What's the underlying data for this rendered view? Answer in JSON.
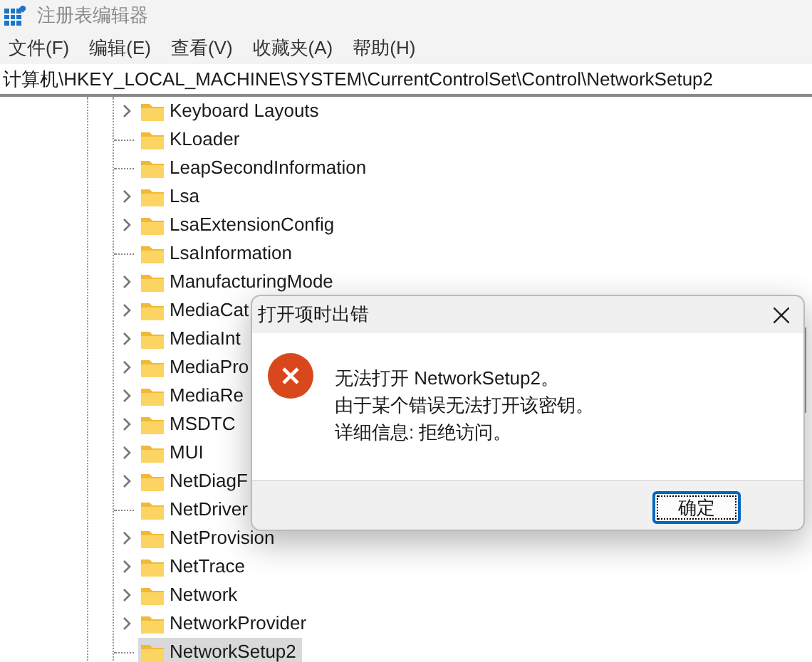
{
  "window": {
    "title": "注册表编辑器"
  },
  "menu": [
    "文件(F)",
    "编辑(E)",
    "查看(V)",
    "收藏夹(A)",
    "帮助(H)"
  ],
  "address": "计算机\\HKEY_LOCAL_MACHINE\\SYSTEM\\CurrentControlSet\\Control\\NetworkSetup2",
  "tree": [
    {
      "label": "Keyboard Layouts",
      "expandable": true,
      "selected": false
    },
    {
      "label": "KLoader",
      "expandable": false,
      "selected": false
    },
    {
      "label": "LeapSecondInformation",
      "expandable": false,
      "selected": false
    },
    {
      "label": "Lsa",
      "expandable": true,
      "selected": false
    },
    {
      "label": "LsaExtensionConfig",
      "expandable": true,
      "selected": false
    },
    {
      "label": "LsaInformation",
      "expandable": false,
      "selected": false
    },
    {
      "label": "ManufacturingMode",
      "expandable": true,
      "selected": false
    },
    {
      "label": "MediaCat",
      "expandable": true,
      "selected": false
    },
    {
      "label": "MediaInt",
      "expandable": true,
      "selected": false
    },
    {
      "label": "MediaPro",
      "expandable": true,
      "selected": false
    },
    {
      "label": "MediaRe",
      "expandable": true,
      "selected": false
    },
    {
      "label": "MSDTC",
      "expandable": true,
      "selected": false
    },
    {
      "label": "MUI",
      "expandable": true,
      "selected": false
    },
    {
      "label": "NetDiagF",
      "expandable": true,
      "selected": false
    },
    {
      "label": "NetDriver",
      "expandable": false,
      "selected": false
    },
    {
      "label": "NetProvision",
      "expandable": true,
      "selected": false
    },
    {
      "label": "NetTrace",
      "expandable": true,
      "selected": false
    },
    {
      "label": "Network",
      "expandable": true,
      "selected": false
    },
    {
      "label": "NetworkProvider",
      "expandable": true,
      "selected": false
    },
    {
      "label": "NetworkSetup2",
      "expandable": false,
      "selected": true
    }
  ],
  "dialog": {
    "title": "打开项时出错",
    "lines": [
      "无法打开 NetworkSetup2。",
      "由于某个错误无法打开该密钥。",
      "详细信息: 拒绝访问。"
    ],
    "button": "确定"
  }
}
